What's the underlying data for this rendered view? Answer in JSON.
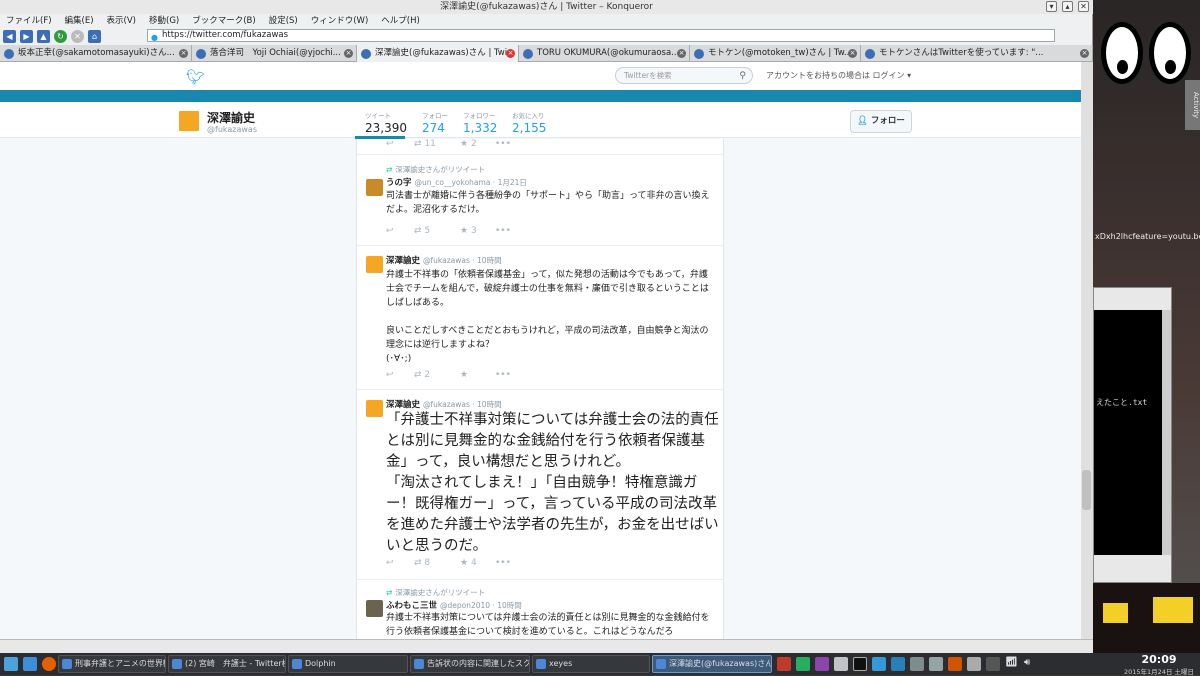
{
  "window": {
    "title": "深澤諭史(@fukazawas)さん | Twitter – Konqueror",
    "menu": [
      "ファイル(F)",
      "編集(E)",
      "表示(V)",
      "移動(G)",
      "ブックマーク(B)",
      "設定(S)",
      "ウィンドウ(W)",
      "ヘルプ(H)"
    ],
    "url": "https://twitter.com/fukazawas"
  },
  "tabs": [
    {
      "label": "坂本正幸(@sakamotomasayuki)さん..."
    },
    {
      "label": "落合洋司　Yoji Ochiai(@yjochi..."
    },
    {
      "label": "深澤諭史(@fukazawas)さん | Twi..."
    },
    {
      "label": "TORU OKUMURA(@okumuraosa..."
    },
    {
      "label": "モトケン(@motoken_tw)さん | Tw..."
    },
    {
      "label": "モトケンさんはTwitterを使っています: \"..."
    }
  ],
  "twitter": {
    "search_placeholder": "Twitterを検索",
    "login_text": "アカウントをお持ちの場合は ログイン ▾",
    "profile": {
      "name": "深澤諭史",
      "handle": "@fukazawas",
      "stats": [
        {
          "label": "ツイート",
          "value": "23,390"
        },
        {
          "label": "フォロー",
          "value": "274"
        },
        {
          "label": "フォロワー",
          "value": "1,332"
        },
        {
          "label": "お気に入り",
          "value": "2,155"
        }
      ],
      "follow_label": "フォロー"
    },
    "tweets": [
      {
        "retweets": "11",
        "favorites": "2"
      },
      {
        "rt_note": "深澤諭史さんがリツイート",
        "name": "うの字",
        "meta": "@un_co__yokohama · 1月21日",
        "text": "司法書士が離婚に伴う各種紛争の「サポート」やら「助言」って非弁の言い換えだよ。泥沼化するだけ。",
        "retweets": "5",
        "favorites": "3"
      },
      {
        "name": "深澤諭史",
        "meta": "@fukazawas · 10時間",
        "text": "弁護士不祥事の「依頼者保護基金」って，似た発想の活動は今でもあって，弁護士会でチームを組んで，破綻弁護士の仕事を無料・廉価で引き取るということはしばしばある。\n\n良いことだしすべきことだとおもうけれど，平成の司法改革，自由競争と淘汰の理念には逆行しますよね？\n(･∀･;)",
        "retweets": "2",
        "favorites": ""
      },
      {
        "name": "深澤諭史",
        "meta": "@fukazawas · 10時間",
        "text": "「弁護士不祥事対策については弁護士会の法的責任とは別に見舞金的な金銭給付を行う依頼者保護基金」って，良い構想だと思うけれど。\n「淘汰されてしまえ！」「自由競争！特権意識ガー！既得権ガー」って，言っている平成の司法改革を進めた弁護士や法学者の先生が，お金を出せばいいと思うのだ。",
        "retweets": "8",
        "favorites": "4"
      },
      {
        "rt_note": "深澤諭史さんがリツイート",
        "name": "ふわもこ三世",
        "meta": "@depon2010 · 10時間",
        "text": "弁護士不祥事対策については弁護士会の法的責任とは別に見舞金的な金銭給付を行う依頼者保護基金について検討を進めていると。これはどうなんだろ"
      }
    ]
  },
  "desktop": {
    "side_tab": "Activity",
    "url_fragment": "xDxh2lhcfeature=youtu.be",
    "terminal_text": "えたこと.txt"
  },
  "taskbar": {
    "tasks": [
      {
        "label": "刑事弁護とアニメの世界観..."
      },
      {
        "label": "(2) 宮崎　弁護士 - Twitter検..."
      },
      {
        "label": "Dolphin"
      },
      {
        "label": "告訴状の内容に関連したスク..."
      },
      {
        "label": "xeyes"
      },
      {
        "label": "深澤諭史(@fukazawas)さん..."
      }
    ],
    "time": "20:09",
    "date": "2015年1月24日 土曜日"
  }
}
